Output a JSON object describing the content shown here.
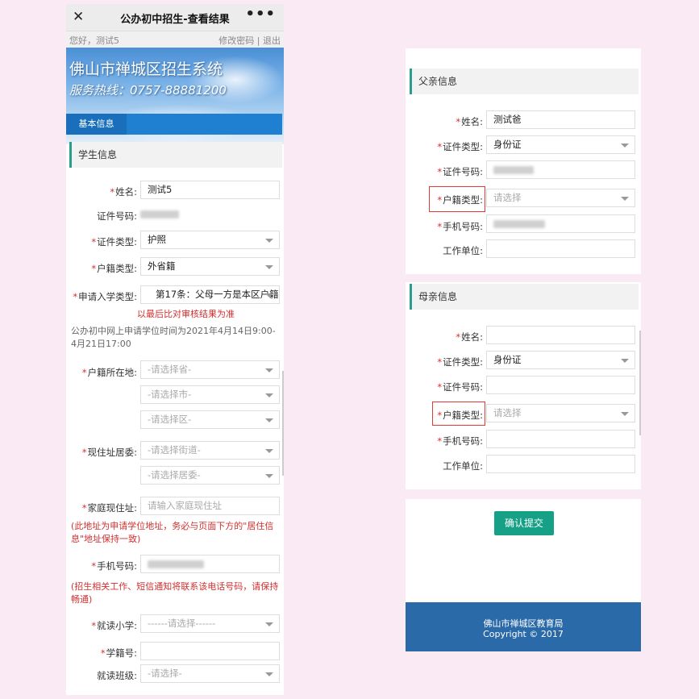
{
  "left": {
    "topbar": {
      "close_icon": "✕",
      "title": "公办初中招生-查看结果",
      "more_icon": "•••"
    },
    "userbar": {
      "greeting": "您好，测试5",
      "change_password": "修改密码",
      "separator": "|",
      "logout": "退出"
    },
    "banner": {
      "site_name": "佛山市禅城区招生系统",
      "hotline": "服务热线：0757-88881200",
      "nav_tab": "基本信息"
    },
    "student_section": "学生信息",
    "fields": {
      "name": {
        "label": "姓名:",
        "value": "测试5"
      },
      "id_number": {
        "label": "证件号码:"
      },
      "id_type": {
        "label": "证件类型:",
        "value": "护照"
      },
      "hukou_type": {
        "label": "户籍类型:",
        "value": "外省籍"
      },
      "apply_type": {
        "label": "申请入学类型:",
        "value": "第17条：父母一方是本区户籍"
      },
      "apply_note": "以最后比对审核结果为准",
      "apply_time": "公办初中网上申请学位时间为2021年4月14日9:00-4月21日17:00",
      "hukou_location": {
        "label": "户籍所在地:",
        "province": "-请选择省-",
        "city": "-请选择市-",
        "district": "-请选择区-"
      },
      "residence": {
        "label": "现住址居委:",
        "street": "-请选择街道-",
        "committee": "-请选择居委-"
      },
      "home_address": {
        "label": "家庭现住址:",
        "placeholder": "请输入家庭现住址"
      },
      "address_note": "(此地址为申请学位地址，务必与页面下方的\"居住信息\"地址保持一致)",
      "phone": {
        "label": "手机号码:"
      },
      "phone_note": "(招生相关工作、短信通知将联系该电话号码，请保持畅通)",
      "primary_school": {
        "label": "就读小学:",
        "placeholder": "------请选择------"
      },
      "student_number": {
        "label": "学籍号:"
      },
      "class": {
        "label": "就读班级:",
        "placeholder": "-请选择-"
      }
    }
  },
  "right": {
    "father": {
      "section": "父亲信息",
      "name": {
        "label": "姓名:",
        "value": "测试爸"
      },
      "id_type": {
        "label": "证件类型:",
        "value": "身份证"
      },
      "id_number": {
        "label": "证件号码:"
      },
      "hukou_type": {
        "label": "户籍类型:",
        "placeholder": "请选择"
      },
      "phone": {
        "label": "手机号码:"
      },
      "employer": {
        "label": "工作单位:"
      }
    },
    "mother": {
      "section": "母亲信息",
      "name": {
        "label": "姓名:"
      },
      "id_type": {
        "label": "证件类型:",
        "value": "身份证"
      },
      "id_number": {
        "label": "证件号码:"
      },
      "hukou_type": {
        "label": "户籍类型:",
        "placeholder": "请选择"
      },
      "phone": {
        "label": "手机号码:"
      },
      "employer": {
        "label": "工作单位:"
      }
    },
    "submit": "确认提交",
    "footer": {
      "org": "佛山市禅城区教育局",
      "copyright": "Copyright © 2017"
    }
  },
  "colors": {
    "accent_green": "#16a085",
    "required_red": "#d32f2f",
    "footer_blue": "#2b6aa8",
    "nav_blue": "#1f7fd0",
    "highlight_box": "#e53935"
  }
}
